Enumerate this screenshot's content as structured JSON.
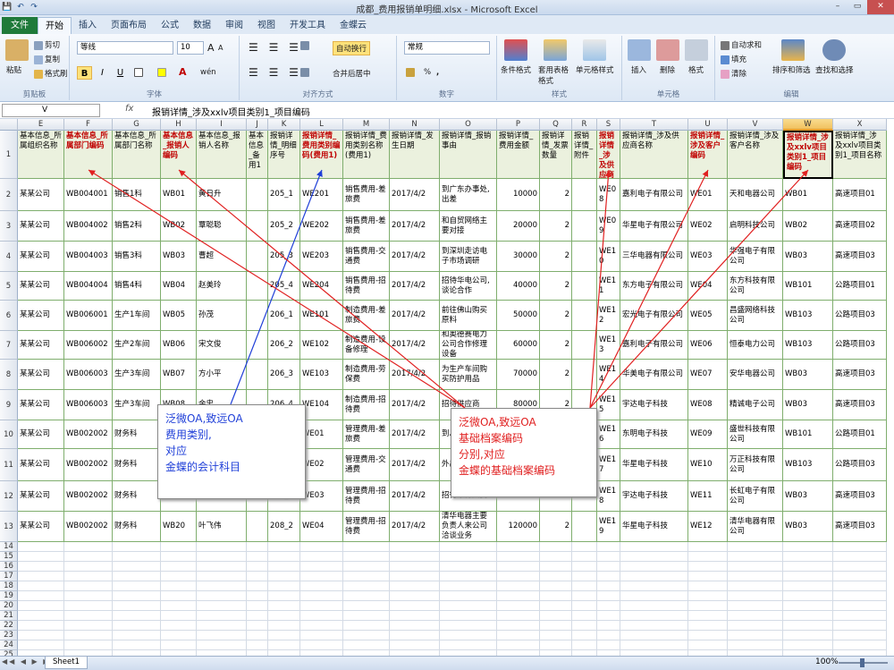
{
  "window": {
    "title": "成都_费用报销单明细.xlsx - Microsoft Excel",
    "qat": [
      "💾",
      "↶",
      "↷"
    ],
    "controls": [
      "–",
      "▭",
      "✕"
    ]
  },
  "tabs": [
    {
      "label": "文件"
    },
    {
      "label": "开始"
    },
    {
      "label": "插入"
    },
    {
      "label": "页面布局"
    },
    {
      "label": "公式"
    },
    {
      "label": "数据"
    },
    {
      "label": "审阅"
    },
    {
      "label": "视图"
    },
    {
      "label": "开发工具"
    },
    {
      "label": "金蝶云"
    }
  ],
  "ribbon": {
    "clipboard": {
      "label": "剪贴板",
      "paste": "粘贴",
      "cut": "剪切",
      "copy": "复制",
      "format_painter": "格式刷"
    },
    "font": {
      "label": "字体",
      "name": "等线",
      "size": "10",
      "bold": "B",
      "italic": "I",
      "underline": "U",
      "grow": "A",
      "shrink": "A",
      "fill": "A",
      "wen": "wén"
    },
    "alignment": {
      "label": "对齐方式",
      "wrap": "自动换行",
      "merge": "合并后居中"
    },
    "number": {
      "label": "数字",
      "format": "常规",
      "percent": "%",
      "comma": ","
    },
    "styles": {
      "label": "样式",
      "cond": "条件格式",
      "table": "套用表格格式",
      "cell": "单元格样式"
    },
    "cells": {
      "label": "单元格",
      "insert": "插入",
      "delete": "删除",
      "format": "格式"
    },
    "editing": {
      "label": "编辑",
      "autosum": "自动求和",
      "fill": "填充",
      "clear": "清除",
      "sort": "排序和筛选",
      "find": "查找和选择"
    }
  },
  "formula_bar": {
    "name_box": "V",
    "formula": "报销详情_涉及xxlv项目类别1_项目编码",
    "fx": "fx"
  },
  "columns": [
    "E",
    "F",
    "G",
    "H",
    "I",
    "J",
    "K",
    "L",
    "M",
    "N",
    "O",
    "P",
    "Q",
    "R",
    "S",
    "T",
    "U",
    "V",
    "W",
    "X"
  ],
  "selected_column": "W",
  "header_row": [
    "基本信息_所属组织名称",
    "基本信息_所属部门编码",
    "基本信息_所属部门名称",
    "基本信息_报销人编码",
    "基本信息_报销人名称",
    "基本信息_备用1",
    "报销详情_明细序号",
    "报销详情_费用类别编码(费用1)",
    "报销详情_费用类别名称(费用1)",
    "报销详情_发生日期",
    "报销详情_报销事由",
    "报销详情_费用金额",
    "报销详情_发票数量",
    "报销详情_附件",
    "报销详情_涉及供应商编码",
    "报销详情_涉及供应商名称",
    "报销详情_涉及客户编码",
    "报销详情_涉及客户名称",
    "报销详情_涉及xxlv项目类别1_项目编码",
    "报销详情_涉及xxlv项目类别1_项目名称"
  ],
  "red_header_cols": [
    "F",
    "H",
    "L",
    "S",
    "U",
    "W"
  ],
  "rows": [
    [
      "某某公司",
      "WB004001",
      "销售1科",
      "WB01",
      "黄日升",
      "",
      "205_1",
      "WE201",
      "销售费用-差旅费",
      "2017/4/2",
      "到广东办事处,出差",
      "10000",
      "2",
      "",
      "WE08",
      "嘉利电子有限公司",
      "WE01",
      "天和电器公司",
      "WB01",
      "高速项目01"
    ],
    [
      "某某公司",
      "WB004002",
      "销售2科",
      "WB02",
      "覃聪聪",
      "",
      "205_2",
      "WE202",
      "销售费用-差旅费",
      "2017/4/2",
      "和自贸网络主要对接",
      "20000",
      "2",
      "",
      "WE09",
      "华星电子有限公司",
      "WE02",
      "启明科技公司",
      "WB02",
      "高速项目02"
    ],
    [
      "某某公司",
      "WB004003",
      "销售3科",
      "WB03",
      "曹超",
      "",
      "205_3",
      "WE203",
      "销售费用-交通费",
      "2017/4/2",
      "到深圳走访电子市场调研",
      "30000",
      "2",
      "",
      "WE10",
      "三华电器有限公司",
      "WE03",
      "华强电子有限公司",
      "WB03",
      "高速项目03"
    ],
    [
      "某某公司",
      "WB004004",
      "销售4科",
      "WB04",
      "赵美玲",
      "",
      "205_4",
      "WE204",
      "销售费用-招待费",
      "2017/4/2",
      "招待华电公司,谈论合作",
      "40000",
      "2",
      "",
      "WE11",
      "东方电子有限公司",
      "WE04",
      "东方科技有限公司",
      "WB101",
      "公路项目01"
    ],
    [
      "某某公司",
      "WB006001",
      "生产1车间",
      "WB05",
      "孙茂",
      "",
      "206_1",
      "WE101",
      "制造费用-差旅费",
      "2017/4/2",
      "前往佛山购买原料",
      "50000",
      "2",
      "",
      "WE12",
      "宏光电子有限公司",
      "WE05",
      "昌盛网络科技公司",
      "WB103",
      "公路项目03"
    ],
    [
      "某某公司",
      "WB006002",
      "生产2车间",
      "WB06",
      "宋文俊",
      "",
      "206_2",
      "WE102",
      "制造费用-设备修理",
      "2017/4/2",
      "和奥德赛电力公司合作修理设备",
      "60000",
      "2",
      "",
      "WE13",
      "嘉利电子有限公司",
      "WE06",
      "恒泰电力公司",
      "WB103",
      "公路项目03"
    ],
    [
      "某某公司",
      "WB006003",
      "生产3车间",
      "WB07",
      "方小平",
      "",
      "206_3",
      "WE103",
      "制造费用-劳保费",
      "2017/4/2",
      "为生产车间购买防护用品",
      "70000",
      "2",
      "",
      "WE14",
      "华美电子有限公司",
      "WE07",
      "安华电器公司",
      "WB03",
      "高速项目03"
    ],
    [
      "某某公司",
      "WB006003",
      "生产3车间",
      "WB08",
      "余忠",
      "",
      "206_4",
      "WE104",
      "制造费用-招待费",
      "2017/4/2",
      "招待供应商",
      "80000",
      "2",
      "",
      "WE15",
      "宇达电子科技",
      "WE08",
      "精诚电子公司",
      "WB03",
      "高速项目03"
    ],
    [
      "某某公司",
      "WB002002",
      "财务科",
      "WB09",
      "罗海",
      "",
      "208_1",
      "WE01",
      "管理费用-差旅费",
      "2017/4/2",
      "到总部出差",
      "90000",
      "2",
      "",
      "WE16",
      "东明电子科技",
      "WE09",
      "盛世科技有限公司",
      "WB101",
      "公路项目01"
    ],
    [
      "某某公司",
      "WB002002",
      "财务科",
      "WB10",
      "王芳",
      "",
      "208_2",
      "WE02",
      "管理费用-交通费",
      "2017/4/2",
      "外出审计",
      "100000",
      "2",
      "",
      "WE17",
      "华星电子科技",
      "WE10",
      "万正科技有限公司",
      "WB103",
      "公路项目03"
    ],
    [
      "某某公司",
      "WB002002",
      "财务科",
      "WB19",
      "龚淑",
      "",
      "208_1",
      "WE03",
      "管理费用-招待费",
      "2017/4/2",
      "招待审计人员",
      "110000",
      "2",
      "",
      "WE18",
      "宇达电子科技",
      "WE11",
      "长虹电子有限公司",
      "WB03",
      "高速项目03"
    ],
    [
      "某某公司",
      "WB002002",
      "财务科",
      "WB20",
      "叶飞伟",
      "",
      "208_2",
      "WE04",
      "管理费用-招待费",
      "2017/4/2",
      "清华电器主要负责人来公司洽谈业务",
      "120000",
      "2",
      "",
      "WE19",
      "华星电子科技",
      "WE12",
      "清华电器有限公司",
      "WB03",
      "高速项目03"
    ]
  ],
  "row_numbers": [
    "1",
    "2",
    "3",
    "4",
    "5",
    "6",
    "7",
    "8",
    "9",
    "10",
    "11",
    "12",
    "13",
    "14",
    "15",
    "16",
    "17",
    "18",
    "19",
    "20",
    "21",
    "22",
    "23",
    "24",
    "25",
    "26"
  ],
  "callouts": [
    {
      "id": "blue",
      "lines": [
        "泛微OA,致远OA",
        "费用类别,",
        "对应",
        "金蝶的会计科目"
      ]
    },
    {
      "id": "red",
      "lines": [
        "泛微OA,致远OA",
        "基础档案编码",
        "分别,对应",
        "金蝶的基础档案编码"
      ]
    }
  ],
  "colors": {
    "accent_blue": "#1f3fd8",
    "accent_red": "#e02020",
    "header_fill": "#ebf1de",
    "grid_green": "#7fae6d",
    "file_tab": "#1f7a3a"
  },
  "status": {
    "sheet": "Sheet1",
    "zoom": "100%",
    "nav": "◀◀ ◀ ▶ ▶▶"
  }
}
